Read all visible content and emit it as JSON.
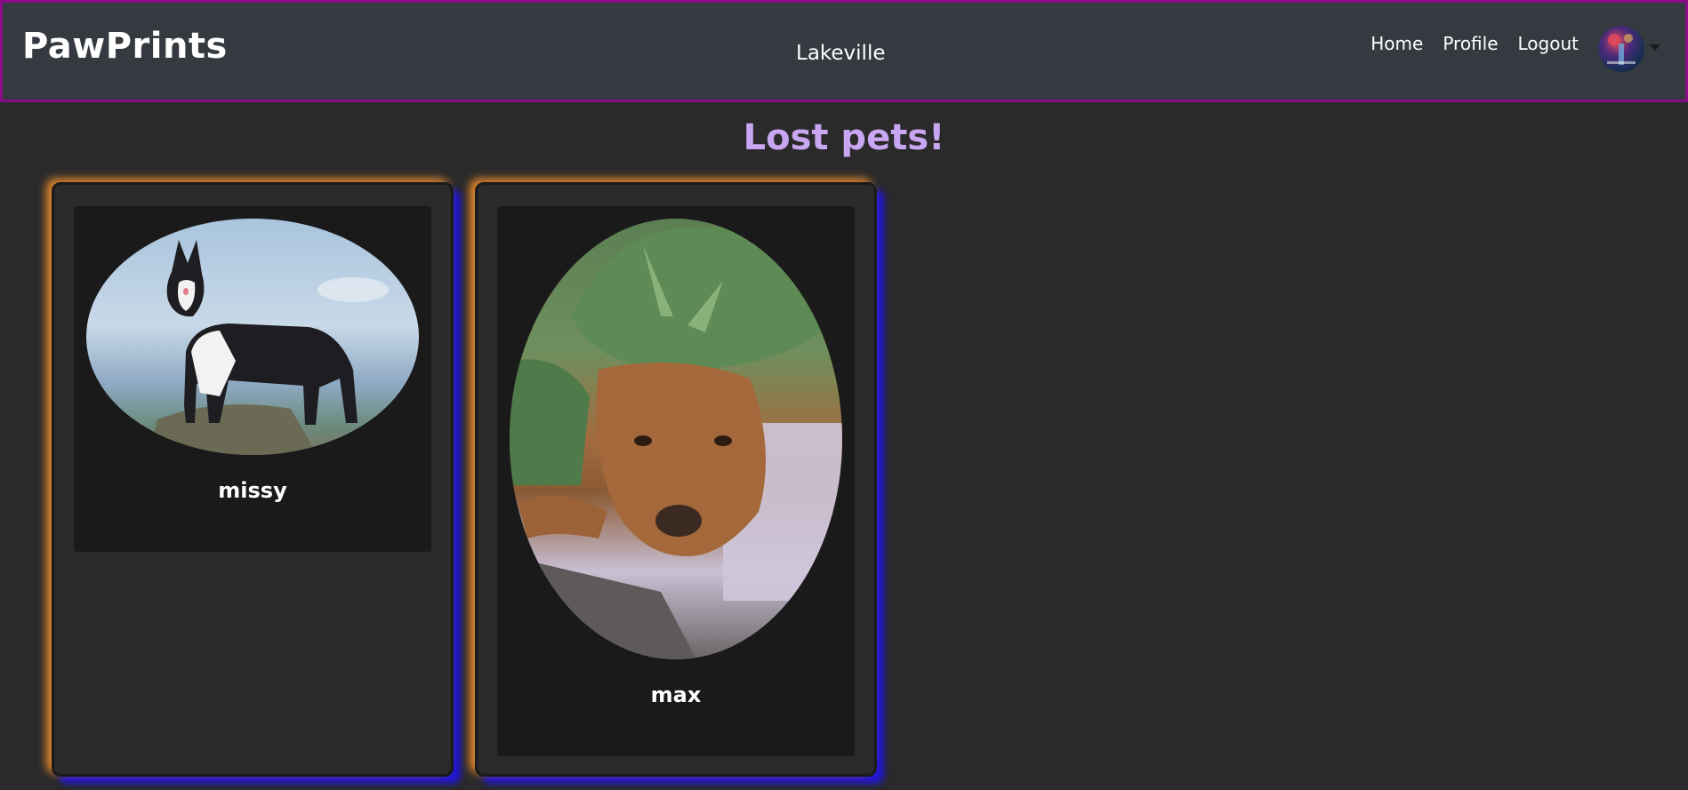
{
  "navbar": {
    "brand": "PawPrints",
    "city": "Lakeville",
    "links": [
      {
        "label": "Home"
      },
      {
        "label": "Profile"
      },
      {
        "label": "Logout"
      }
    ]
  },
  "main": {
    "title": "Lost pets!",
    "pets": [
      {
        "name": "missy",
        "photo": "husky-dog-photo"
      },
      {
        "name": "max",
        "photo": "dog-in-dinosaur-costume-photo"
      }
    ]
  },
  "colors": {
    "navbar_bg": "#343a40",
    "navbar_border": "#8b0b8b",
    "page_bg": "#2a2a2a",
    "title": "#c9a6f2",
    "card_glow_orange": "#e68a2e",
    "card_glow_blue": "#2014d8"
  }
}
